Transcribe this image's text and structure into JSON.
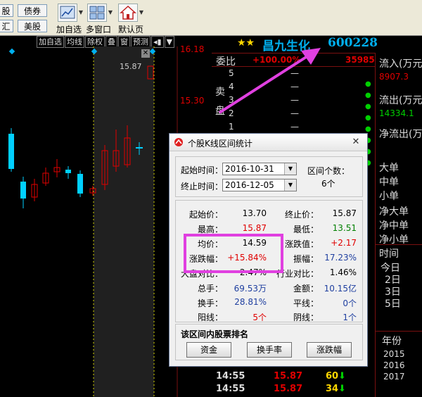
{
  "toolbar": {
    "left_buttons": [
      {
        "label": "股"
      },
      {
        "label": "债券"
      },
      {
        "label": "汇"
      },
      {
        "label": "美股"
      }
    ],
    "tools": [
      {
        "label": "加自选",
        "icon": "add-watchlist-icon"
      },
      {
        "label": "多窗口",
        "icon": "multi-window-icon"
      },
      {
        "label": "默认页",
        "icon": "home-icon"
      }
    ]
  },
  "chart_toolbar": {
    "buttons": [
      "加自选",
      "均线",
      "除权",
      "叠",
      "窗",
      "预测"
    ]
  },
  "chart": {
    "price_high": "16.18",
    "price_mid": "15.30",
    "marker": "15.87"
  },
  "stock": {
    "name": "昌九生化",
    "code": "600228",
    "stars": "★★"
  },
  "order_book": {
    "ratio_label": "委比",
    "ratio_value": "+100.00%",
    "ratio_count": "35985",
    "side_labels": [
      "卖",
      "盘"
    ],
    "levels": [
      "5",
      "4",
      "3",
      "2",
      "1"
    ],
    "dash": "—"
  },
  "right_panel": {
    "inflow_label": "流入(万元",
    "inflow_value": "8907.3",
    "outflow_label": "流出(万元",
    "outflow_value": "14334.1",
    "net_label": "净流出(万",
    "rows": [
      "大单",
      "中单",
      "小单",
      "净大单",
      "净中单",
      "净小单"
    ],
    "time_label": "时间",
    "days": [
      "今日",
      "2日",
      "3日",
      "5日"
    ],
    "year_label": "年份",
    "years": [
      "2015",
      "2016",
      "2017"
    ]
  },
  "bottom_ticks": [
    {
      "time": "14:55",
      "price": "15.87",
      "vol": "60"
    },
    {
      "time": "14:55",
      "price": "15.87",
      "vol": "34"
    }
  ],
  "dialog": {
    "title": "个股K线区间统计",
    "start_label": "起始时间：",
    "start_value": "2016-10-31",
    "end_label": "终止时间：",
    "end_value": "2016-12-05",
    "period_label": "区间个数：",
    "period_value": "6个",
    "stats": {
      "start_price_label": "起始价：",
      "start_price": "13.70",
      "end_price_label": "终止价：",
      "end_price": "15.87",
      "high_label": "最高：",
      "high": "15.87",
      "low_label": "最低：",
      "low": "13.51",
      "avg_label": "均价：",
      "avg": "14.59",
      "change_value_label": "涨跌值：",
      "change_value": "+2.17",
      "change_pct_label": "涨跌幅：",
      "change_pct": "+15.84%",
      "amplitude_label": "振幅：",
      "amplitude": "17.23%",
      "compare_label": "大盘对比：",
      "compare": "2.47%",
      "industry_label": "行业对比：",
      "industry": "1.46%",
      "volume_label": "总手：",
      "volume": "69.53万",
      "amount_label": "金额：",
      "amount": "10.15亿",
      "turnover_label": "换手：",
      "turnover": "28.81%",
      "flat_label": "平线：",
      "flat": "0个",
      "up_label": "阳线：",
      "up": "5个",
      "down_label": "阴线：",
      "down": "1个"
    },
    "rank_title": "该区间内股票排名",
    "buttons": [
      "资金",
      "换手率",
      "涨跌幅"
    ]
  },
  "colors": {
    "up": "#e00000",
    "down": "#00d0ff",
    "highlight_box": "#e040e0",
    "stock_name": "#00b0f0"
  }
}
